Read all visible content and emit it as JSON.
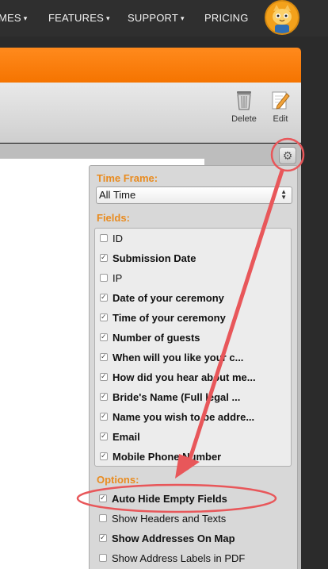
{
  "nav": {
    "items": [
      {
        "label": "MES",
        "caret": "▾"
      },
      {
        "label": "FEATURES",
        "caret": "▾"
      },
      {
        "label": "SUPPORT",
        "caret": "▾"
      },
      {
        "label": "PRICING",
        "caret": ""
      }
    ],
    "avatar_icon": "cat-avatar-icon"
  },
  "toolbar": {
    "delete_label": "Delete",
    "edit_label": "Edit"
  },
  "settings": {
    "gear_icon": "gear-icon",
    "time_frame_label": "Time Frame:",
    "time_frame_value": "All Time",
    "fields_label": "Fields:",
    "fields": [
      {
        "label": "ID",
        "checked": false,
        "bold": false
      },
      {
        "label": "Submission Date",
        "checked": true,
        "bold": true
      },
      {
        "label": "IP",
        "checked": false,
        "bold": false
      },
      {
        "label": "Date of your ceremony",
        "checked": true,
        "bold": true
      },
      {
        "label": "Time of your ceremony",
        "checked": true,
        "bold": true
      },
      {
        "label": "Number of guests",
        "checked": true,
        "bold": true
      },
      {
        "label": "When will you like your c...",
        "checked": true,
        "bold": true
      },
      {
        "label": "How did you hear about me...",
        "checked": true,
        "bold": true
      },
      {
        "label": "Bride's Name (Full legal ...",
        "checked": true,
        "bold": true
      },
      {
        "label": "Name you wish to be addre...",
        "checked": true,
        "bold": true
      },
      {
        "label": "Email",
        "checked": true,
        "bold": true
      },
      {
        "label": "Mobile Phone Number",
        "checked": true,
        "bold": true
      }
    ],
    "options_label": "Options:",
    "options": [
      {
        "label": "Auto Hide Empty Fields",
        "checked": true,
        "bold": true
      },
      {
        "label": "Show Headers and Texts",
        "checked": false,
        "bold": false
      },
      {
        "label": "Show Addresses On Map",
        "checked": true,
        "bold": true
      },
      {
        "label": "Show Address Labels in PDF",
        "checked": false,
        "bold": false
      }
    ]
  },
  "colors": {
    "accent_orange": "#f57400",
    "section_label": "#e98b1f",
    "annotation_red": "#e8575a"
  }
}
